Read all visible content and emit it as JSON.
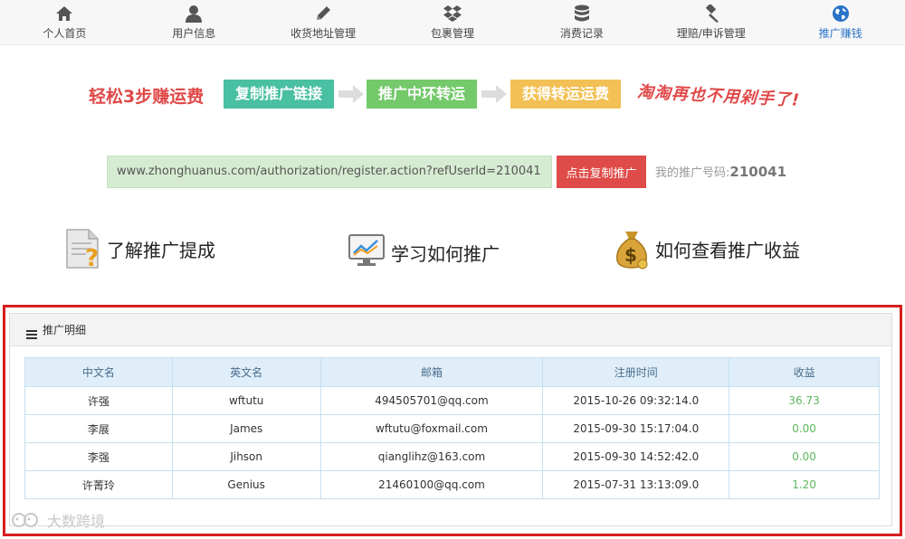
{
  "nav": {
    "items": [
      {
        "label": "个人首页",
        "icon": "home-icon"
      },
      {
        "label": "用户信息",
        "icon": "user-icon"
      },
      {
        "label": "收货地址管理",
        "icon": "pencil-icon"
      },
      {
        "label": "包裹管理",
        "icon": "dropbox-icon"
      },
      {
        "label": "消费记录",
        "icon": "database-icon"
      },
      {
        "label": "理赔/申诉管理",
        "icon": "gavel-icon"
      },
      {
        "label": "推广赚钱",
        "icon": "globe-icon",
        "active": true
      }
    ]
  },
  "promo": {
    "title": "轻松3步赚运费",
    "steps": [
      "复制推广链接",
      "推广中环转运",
      "获得转运运费"
    ],
    "slogan": "淘淘再也不用剁手了!"
  },
  "referral": {
    "link": "www.zhonghuanus.com/authorization/register.action?refUserId=210041",
    "copy_button": "点击复制推广",
    "code_label": "我的推广号码:",
    "code_value": "210041"
  },
  "help": {
    "items": [
      {
        "label": "了解推广提成",
        "icon": "document-question-icon"
      },
      {
        "label": "学习如何推广",
        "icon": "monitor-chart-icon"
      },
      {
        "label": "如何查看推广收益",
        "icon": "money-bag-icon"
      }
    ]
  },
  "detail": {
    "title": "推广明细",
    "columns": [
      "中文名",
      "英文名",
      "邮箱",
      "注册时间",
      "收益"
    ],
    "rows": [
      [
        "许强",
        "wftutu",
        "494505701@qq.com",
        "2015-10-26 09:32:14.0",
        "36.73"
      ],
      [
        "李展",
        "James",
        "wftutu@foxmail.com",
        "2015-09-30 15:17:04.0",
        "0.00"
      ],
      [
        "李强",
        "Jihson",
        "qianglihz@163.com",
        "2015-09-30 14:52:42.0",
        "0.00"
      ],
      [
        "许菁玲",
        "Genius",
        "21460100@qq.com",
        "2015-07-31 13:13:09.0",
        "1.20"
      ]
    ]
  },
  "watermark": "大数跨境",
  "colors": {
    "accent_blue": "#2a73c7",
    "promo_red": "#e04848",
    "step1": "#4ac0a2",
    "step2": "#74c96b",
    "step3": "#f2c055",
    "copy_button": "#de4b48",
    "profit_green": "#5cb85c",
    "highlight_frame": "#d51e1e"
  }
}
